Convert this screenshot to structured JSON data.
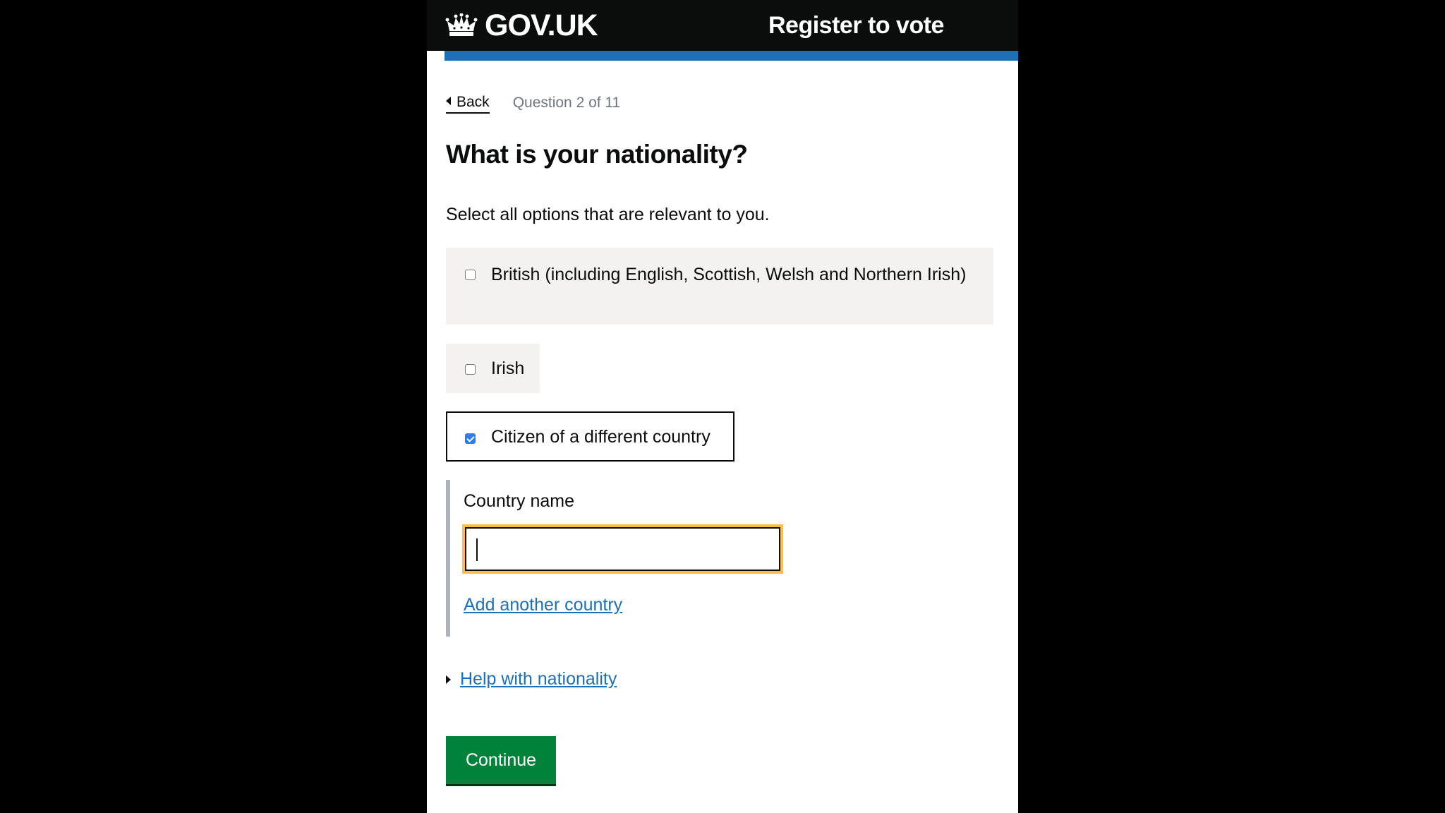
{
  "header": {
    "logo_text": "GOV.UK",
    "service_name": "Register to vote"
  },
  "nav": {
    "back_label": "Back",
    "progress_text": "Question 2 of 11"
  },
  "question": {
    "title": "What is your nationality?",
    "hint": "Select all options that are relevant to you."
  },
  "options": [
    {
      "label": "British (including English, Scottish, Welsh and Northern Irish)",
      "checked": false
    },
    {
      "label": "Irish",
      "checked": false
    },
    {
      "label": "Citizen of a different country",
      "checked": true
    }
  ],
  "country": {
    "label": "Country name",
    "value": "",
    "add_link": "Add another country"
  },
  "help": {
    "summary": "Help with nationality"
  },
  "actions": {
    "continue_label": "Continue"
  },
  "colors": {
    "header_bg": "#0b0c0c",
    "accent_blue": "#1d70b8",
    "link": "#1d70b8",
    "focus": "#ffbf47",
    "button_green": "#00823b",
    "checkbox_checked": "#2b7de9",
    "option_bg": "#f3f2f1"
  },
  "icons": {
    "logo": "crown-icon",
    "back": "triangle-left-icon",
    "details": "triangle-right-icon",
    "checkbox_checked": "checkmark-icon"
  }
}
